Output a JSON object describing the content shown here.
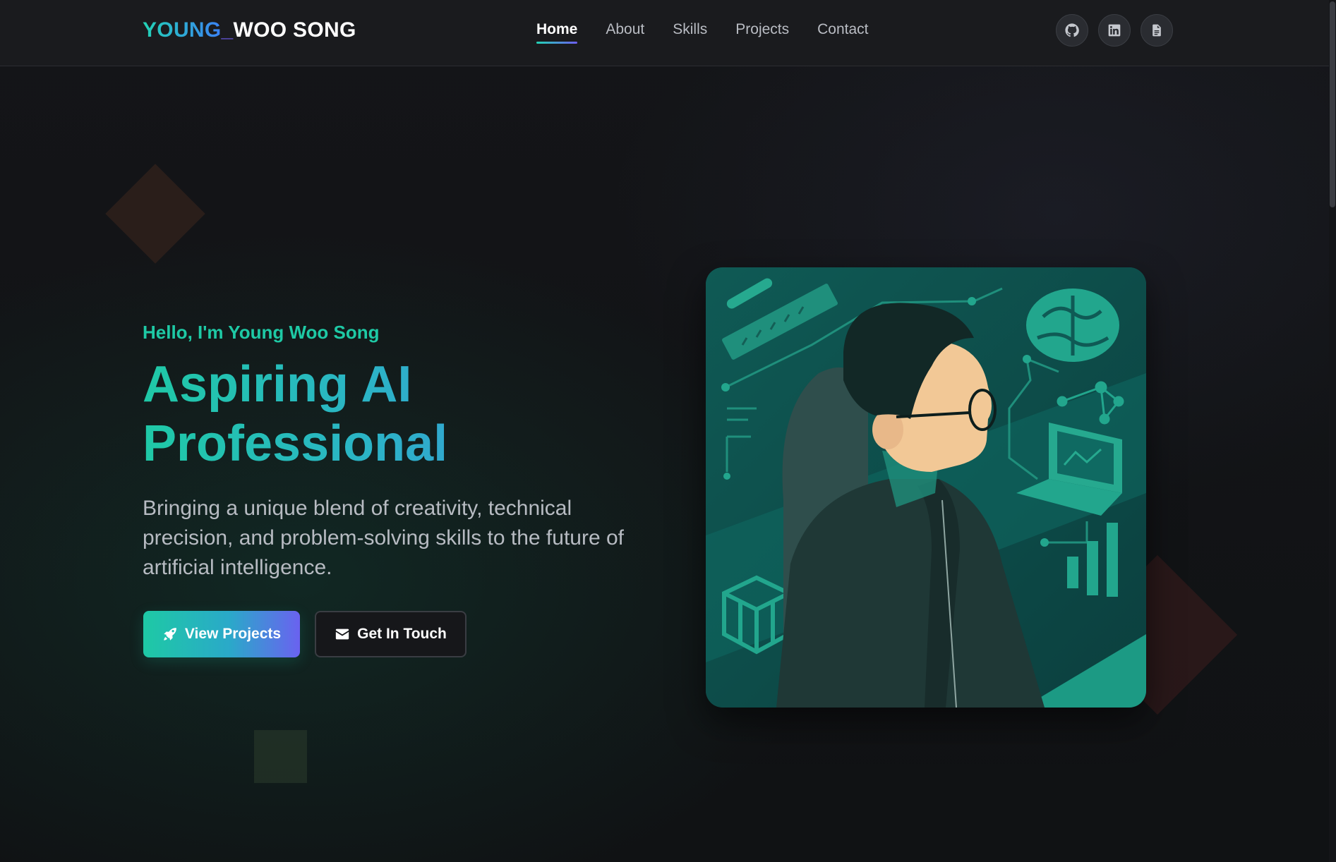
{
  "nav": {
    "logo": {
      "part1": "YOUNG",
      "underscore": "_",
      "part2": "WOO SONG"
    },
    "links": [
      {
        "label": "Home",
        "active": true
      },
      {
        "label": "About",
        "active": false
      },
      {
        "label": "Skills",
        "active": false
      },
      {
        "label": "Projects",
        "active": false
      },
      {
        "label": "Contact",
        "active": false
      }
    ],
    "socials": [
      {
        "icon": "github-icon"
      },
      {
        "icon": "linkedin-icon"
      },
      {
        "icon": "document-icon"
      }
    ]
  },
  "hero": {
    "greeting": "Hello, I'm Young Woo Song",
    "headline_line1": "Aspiring AI",
    "headline_line2": "Professional",
    "description": "Bringing a unique blend of creativity, technical precision, and problem-solving skills to the future of artificial intelligence.",
    "primary_button": {
      "label": "View Projects",
      "icon": "rocket-icon"
    },
    "secondary_button": {
      "label": "Get In Touch",
      "icon": "envelope-icon"
    }
  },
  "colors": {
    "accent_teal": "#1ec9a5",
    "accent_blue": "#3b82f6",
    "accent_purple": "#6a62f0",
    "background": "#121316",
    "card_background": "#0f5350"
  }
}
